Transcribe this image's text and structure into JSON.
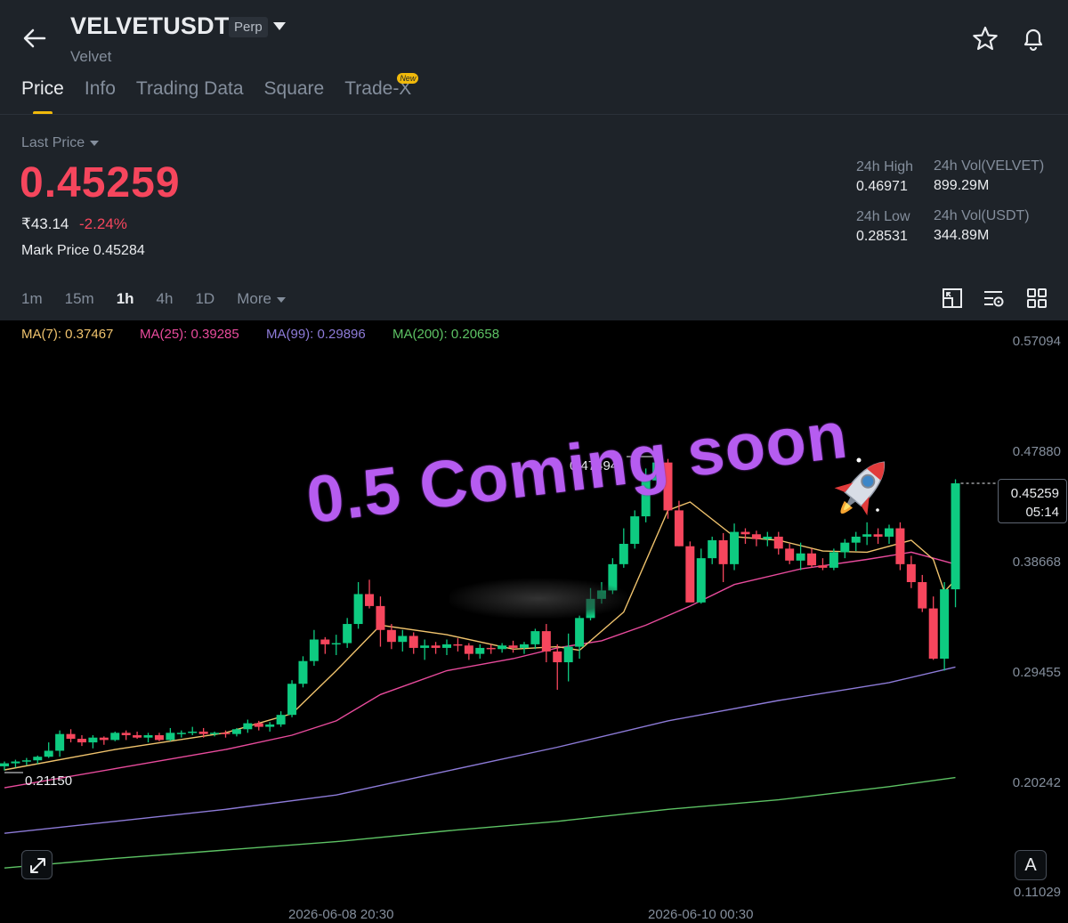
{
  "header": {
    "symbol": "VELVETUSDT",
    "contract_type": "Perp",
    "name": "Velvet"
  },
  "tabs": [
    {
      "label": "Price",
      "active": true
    },
    {
      "label": "Info"
    },
    {
      "label": "Trading Data"
    },
    {
      "label": "Square"
    },
    {
      "label": "Trade-X",
      "badge": "New"
    }
  ],
  "ticker": {
    "last_price_label": "Last Price",
    "last_price": "0.45259",
    "inr_price": "₹43.14",
    "change_pct": "-2.24%",
    "mark_price_label": "Mark Price",
    "mark_price": "0.45284",
    "high_label": "24h High",
    "high": "0.46971",
    "low_label": "24h Low",
    "low": "0.28531",
    "vol_base_label": "24h Vol(VELVET)",
    "vol_base": "899.29M",
    "vol_quote_label": "24h Vol(USDT)",
    "vol_quote": "344.89M"
  },
  "intervals": [
    "1m",
    "15m",
    "1h",
    "4h",
    "1D",
    "More"
  ],
  "active_interval": "1h",
  "ma_legend": {
    "ma7": "MA(7): 0.37467",
    "ma25": "MA(25): 0.39285",
    "ma99": "MA(99): 0.29896",
    "ma200": "MA(200): 0.20658"
  },
  "colors": {
    "up": "#0ECB81",
    "down": "#F6465D",
    "ma7": "#F0C36D",
    "ma25": "#E84B9C",
    "ma99": "#8D7BD8",
    "ma200": "#5DC264",
    "accent": "#F0B90B"
  },
  "chart_data": {
    "type": "candlestick",
    "y_ticks": [
      "0.57094",
      "0.47880",
      "0.38668",
      "0.29455",
      "0.20242",
      "0.11029"
    ],
    "x_ticks": [
      "2026-06-08 20:30",
      "2026-06-10 00:30"
    ],
    "current_price": "0.45259",
    "countdown": "05:14",
    "high_annotation": "0.47494",
    "low_annotation": "0.21150",
    "ylim": [
      0.11029,
      0.57094
    ],
    "candles": [
      [
        0.216,
        0.22,
        0.2125,
        0.2185
      ],
      [
        0.2185,
        0.2215,
        0.215,
        0.22
      ],
      [
        0.22,
        0.223,
        0.217,
        0.221
      ],
      [
        0.221,
        0.225,
        0.218,
        0.224
      ],
      [
        0.224,
        0.236,
        0.223,
        0.229
      ],
      [
        0.229,
        0.246,
        0.224,
        0.243
      ],
      [
        0.243,
        0.247,
        0.236,
        0.239
      ],
      [
        0.239,
        0.242,
        0.233,
        0.236
      ],
      [
        0.236,
        0.242,
        0.231,
        0.24
      ],
      [
        0.24,
        0.241,
        0.234,
        0.238
      ],
      [
        0.238,
        0.245,
        0.237,
        0.244
      ],
      [
        0.244,
        0.246,
        0.238,
        0.242
      ],
      [
        0.242,
        0.245,
        0.239,
        0.24
      ],
      [
        0.24,
        0.244,
        0.236,
        0.242
      ],
      [
        0.242,
        0.244,
        0.237,
        0.238
      ],
      [
        0.238,
        0.248,
        0.237,
        0.244
      ],
      [
        0.244,
        0.246,
        0.24,
        0.244
      ],
      [
        0.244,
        0.249,
        0.242,
        0.245
      ],
      [
        0.245,
        0.248,
        0.24,
        0.243
      ],
      [
        0.243,
        0.245,
        0.241,
        0.244
      ],
      [
        0.244,
        0.246,
        0.24,
        0.243
      ],
      [
        0.243,
        0.248,
        0.241,
        0.247
      ],
      [
        0.247,
        0.255,
        0.244,
        0.252
      ],
      [
        0.252,
        0.254,
        0.246,
        0.249
      ],
      [
        0.249,
        0.253,
        0.245,
        0.251
      ],
      [
        0.251,
        0.262,
        0.249,
        0.259
      ],
      [
        0.259,
        0.288,
        0.257,
        0.285
      ],
      [
        0.285,
        0.308,
        0.282,
        0.304
      ],
      [
        0.304,
        0.33,
        0.3,
        0.322
      ],
      [
        0.322,
        0.324,
        0.31,
        0.318
      ],
      [
        0.318,
        0.326,
        0.309,
        0.319
      ],
      [
        0.319,
        0.34,
        0.315,
        0.335
      ],
      [
        0.335,
        0.37,
        0.331,
        0.36
      ],
      [
        0.36,
        0.372,
        0.348,
        0.35
      ],
      [
        0.35,
        0.358,
        0.316,
        0.33
      ],
      [
        0.33,
        0.335,
        0.314,
        0.32
      ],
      [
        0.32,
        0.33,
        0.312,
        0.325
      ],
      [
        0.325,
        0.328,
        0.31,
        0.315
      ],
      [
        0.315,
        0.322,
        0.305,
        0.317
      ],
      [
        0.317,
        0.32,
        0.31,
        0.315
      ],
      [
        0.315,
        0.322,
        0.309,
        0.318
      ],
      [
        0.318,
        0.323,
        0.312,
        0.317
      ],
      [
        0.317,
        0.319,
        0.305,
        0.31
      ],
      [
        0.31,
        0.318,
        0.306,
        0.315
      ],
      [
        0.315,
        0.318,
        0.31,
        0.314
      ],
      [
        0.314,
        0.319,
        0.311,
        0.317
      ],
      [
        0.317,
        0.321,
        0.311,
        0.315
      ],
      [
        0.315,
        0.32,
        0.31,
        0.318
      ],
      [
        0.318,
        0.331,
        0.314,
        0.329
      ],
      [
        0.329,
        0.335,
        0.303,
        0.312
      ],
      [
        0.312,
        0.318,
        0.28,
        0.303
      ],
      [
        0.303,
        0.327,
        0.287,
        0.316
      ],
      [
        0.316,
        0.342,
        0.306,
        0.34
      ],
      [
        0.34,
        0.365,
        0.338,
        0.356
      ],
      [
        0.356,
        0.37,
        0.352,
        0.363
      ],
      [
        0.363,
        0.39,
        0.36,
        0.385
      ],
      [
        0.385,
        0.415,
        0.382,
        0.402
      ],
      [
        0.402,
        0.43,
        0.398,
        0.425
      ],
      [
        0.425,
        0.465,
        0.42,
        0.455
      ],
      [
        0.455,
        0.4749,
        0.446,
        0.47
      ],
      [
        0.47,
        0.473,
        0.423,
        0.43
      ],
      [
        0.43,
        0.438,
        0.4,
        0.4
      ],
      [
        0.4,
        0.404,
        0.355,
        0.353
      ],
      [
        0.353,
        0.398,
        0.352,
        0.39
      ],
      [
        0.39,
        0.408,
        0.385,
        0.405
      ],
      [
        0.405,
        0.411,
        0.37,
        0.385
      ],
      [
        0.385,
        0.419,
        0.38,
        0.412
      ],
      [
        0.412,
        0.415,
        0.402,
        0.41
      ],
      [
        0.41,
        0.413,
        0.4,
        0.406
      ],
      [
        0.406,
        0.412,
        0.4,
        0.408
      ],
      [
        0.408,
        0.412,
        0.393,
        0.398
      ],
      [
        0.398,
        0.402,
        0.385,
        0.388
      ],
      [
        0.388,
        0.403,
        0.38,
        0.394
      ],
      [
        0.394,
        0.398,
        0.382,
        0.384
      ],
      [
        0.384,
        0.39,
        0.38,
        0.382
      ],
      [
        0.382,
        0.398,
        0.38,
        0.395
      ],
      [
        0.395,
        0.406,
        0.39,
        0.403
      ],
      [
        0.403,
        0.412,
        0.396,
        0.408
      ],
      [
        0.408,
        0.42,
        0.401,
        0.41
      ],
      [
        0.41,
        0.415,
        0.402,
        0.408
      ],
      [
        0.408,
        0.418,
        0.402,
        0.415
      ],
      [
        0.415,
        0.42,
        0.38,
        0.385
      ],
      [
        0.385,
        0.392,
        0.365,
        0.37
      ],
      [
        0.37,
        0.376,
        0.345,
        0.348
      ],
      [
        0.348,
        0.358,
        0.305,
        0.306
      ],
      [
        0.306,
        0.37,
        0.296,
        0.364
      ],
      [
        0.364,
        0.456,
        0.349,
        0.4526
      ]
    ],
    "ma_lines": {
      "ma7": [
        [
          0,
          0.213
        ],
        [
          10,
          0.23
        ],
        [
          20,
          0.244
        ],
        [
          26,
          0.26
        ],
        [
          30,
          0.296
        ],
        [
          34,
          0.334
        ],
        [
          40,
          0.326
        ],
        [
          46,
          0.314
        ],
        [
          50,
          0.316
        ],
        [
          52,
          0.313
        ],
        [
          56,
          0.345
        ],
        [
          60,
          0.43
        ],
        [
          62,
          0.437
        ],
        [
          66,
          0.408
        ],
        [
          70,
          0.405
        ],
        [
          74,
          0.396
        ],
        [
          78,
          0.395
        ],
        [
          82,
          0.405
        ],
        [
          84,
          0.389
        ],
        [
          85,
          0.362
        ],
        [
          86,
          0.372
        ]
      ],
      "ma25": [
        [
          0,
          0.198
        ],
        [
          10,
          0.214
        ],
        [
          20,
          0.23
        ],
        [
          26,
          0.242
        ],
        [
          30,
          0.254
        ],
        [
          34,
          0.276
        ],
        [
          40,
          0.296
        ],
        [
          46,
          0.306
        ],
        [
          50,
          0.315
        ],
        [
          54,
          0.321
        ],
        [
          58,
          0.334
        ],
        [
          62,
          0.35
        ],
        [
          66,
          0.368
        ],
        [
          72,
          0.381
        ],
        [
          78,
          0.389
        ],
        [
          82,
          0.395
        ],
        [
          84,
          0.39
        ],
        [
          86,
          0.385
        ]
      ],
      "ma99": [
        [
          0,
          0.16
        ],
        [
          10,
          0.17
        ],
        [
          20,
          0.18
        ],
        [
          30,
          0.192
        ],
        [
          40,
          0.212
        ],
        [
          50,
          0.232
        ],
        [
          60,
          0.254
        ],
        [
          70,
          0.271
        ],
        [
          80,
          0.286
        ],
        [
          86,
          0.299
        ]
      ],
      "ma200": [
        [
          0,
          0.131
        ],
        [
          10,
          0.139
        ],
        [
          20,
          0.146
        ],
        [
          30,
          0.153
        ],
        [
          40,
          0.162
        ],
        [
          50,
          0.17
        ],
        [
          60,
          0.18
        ],
        [
          70,
          0.188
        ],
        [
          80,
          0.199
        ],
        [
          86,
          0.2066
        ]
      ]
    }
  },
  "overlay": {
    "caption": "0.5 Coming soon"
  }
}
